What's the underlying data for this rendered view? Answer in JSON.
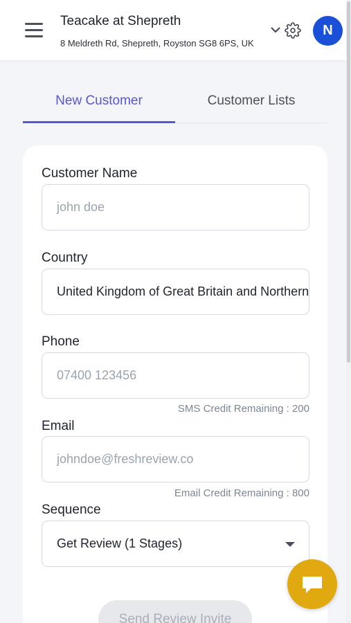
{
  "header": {
    "business_name": "Teacake at Shepreth",
    "business_address": "8 Meldreth Rd, Shepreth, Royston SG8 6PS, UK",
    "avatar_initial": "N",
    "icons": [
      "menu-icon",
      "chevron-down-icon",
      "gear-icon"
    ]
  },
  "tabs": [
    {
      "label": "New Customer",
      "active": true
    },
    {
      "label": "Customer Lists",
      "active": false
    }
  ],
  "form": {
    "customer_name": {
      "label": "Customer Name",
      "placeholder": "john doe",
      "value": ""
    },
    "country": {
      "label": "Country",
      "value": "United Kingdom of Great Britain and Northern Ireland"
    },
    "phone": {
      "label": "Phone",
      "placeholder": "07400 123456",
      "value": "",
      "credit": "SMS Credit Remaining : 200"
    },
    "email": {
      "label": "Email",
      "placeholder": "johndoe@freshreview.co",
      "value": "",
      "credit": "Email Credit Remaining : 800"
    },
    "sequence": {
      "label": "Sequence",
      "value": "Get Review (1 Stages)"
    },
    "submit_label": "Send Review Invite"
  },
  "colors": {
    "accent": "#5a55d6",
    "avatar": "#1a4fd8",
    "chat_button": "#e0a90f",
    "background": "#f3f5f8"
  }
}
